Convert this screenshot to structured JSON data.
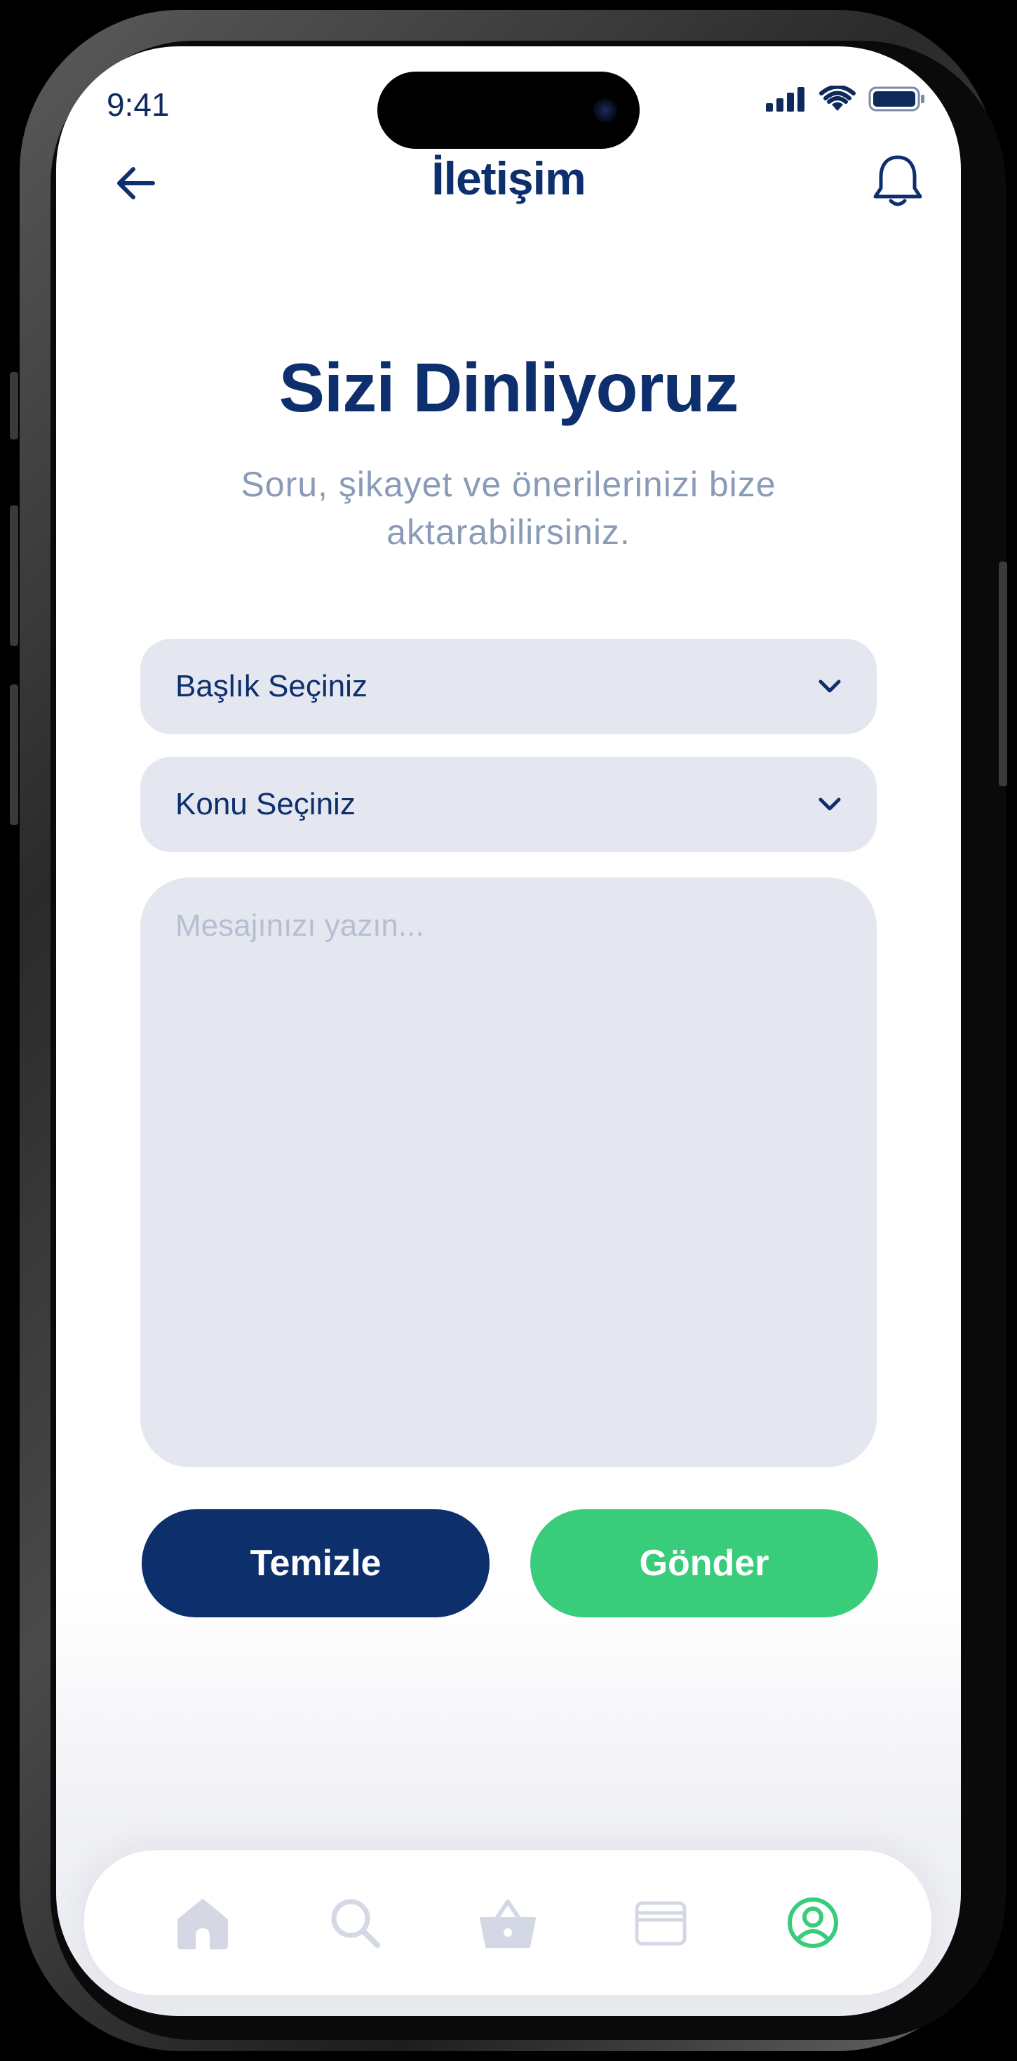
{
  "status": {
    "time": "9:41"
  },
  "header": {
    "title": "İletişim"
  },
  "hero": {
    "title": "Sizi Dinliyoruz",
    "subtitle": "Soru, şikayet ve önerilerinizi bize aktarabilirsiniz."
  },
  "form": {
    "subject_select": {
      "label": "Başlık Seçiniz"
    },
    "topic_select": {
      "label": "Konu Seçiniz"
    },
    "message": {
      "placeholder": "Mesajınızı yazın..."
    },
    "clear_label": "Temizle",
    "send_label": "Gönder"
  },
  "tabbar": {
    "items": [
      {
        "icon": "home-icon",
        "active": false
      },
      {
        "icon": "search-icon",
        "active": false
      },
      {
        "icon": "basket-icon",
        "active": false
      },
      {
        "icon": "wallet-icon",
        "active": false
      },
      {
        "icon": "profile-icon",
        "active": true
      }
    ]
  },
  "colors": {
    "primary": "#0d2f6b",
    "accent": "#38cc7b",
    "field": "#e4e7ef",
    "muted": "#8a9bb8",
    "tab_inactive": "#d3d8e4"
  }
}
